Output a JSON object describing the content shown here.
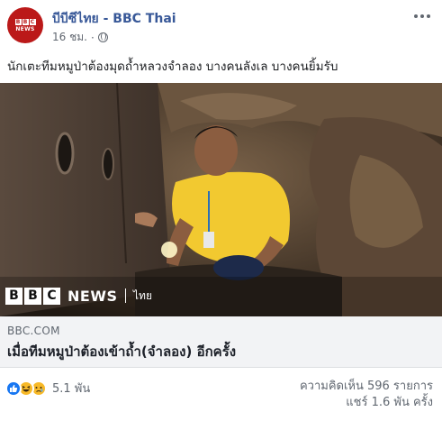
{
  "header": {
    "page_name": "บีบีซีไทย - BBC Thai",
    "time": "16 ชม.",
    "separator": "·",
    "avatar_text": {
      "letters": [
        "B",
        "B",
        "C"
      ],
      "word": "NEWS"
    }
  },
  "post": {
    "text": "นักเตะทีมหมูป่าต้องมุดถ้ำหลวงจำลอง บางคนลังเล บางคนยิ้มรับ"
  },
  "photo": {
    "overlay": {
      "letters": [
        "B",
        "B",
        "C"
      ],
      "news": "NEWS",
      "language": "ไทย"
    }
  },
  "link_preview": {
    "domain": "BBC.COM",
    "title": "เมื่อทีมหมูป่าต้องเข้าถ้ำ(จำลอง) อีกครั้ง"
  },
  "engagement": {
    "reaction_count": "5.1 พัน",
    "comments": "ความคิดเห็น 596 รายการ",
    "shares": "แชร์ 1.6 พัน ครั้ง",
    "reactions": [
      "like-icon",
      "haha-icon",
      "sad-icon"
    ]
  },
  "colors": {
    "bbc_red": "#bb1919",
    "link_blue": "#385898",
    "like_blue": "#1877f2",
    "emoji_yellow": "#f7b928"
  }
}
